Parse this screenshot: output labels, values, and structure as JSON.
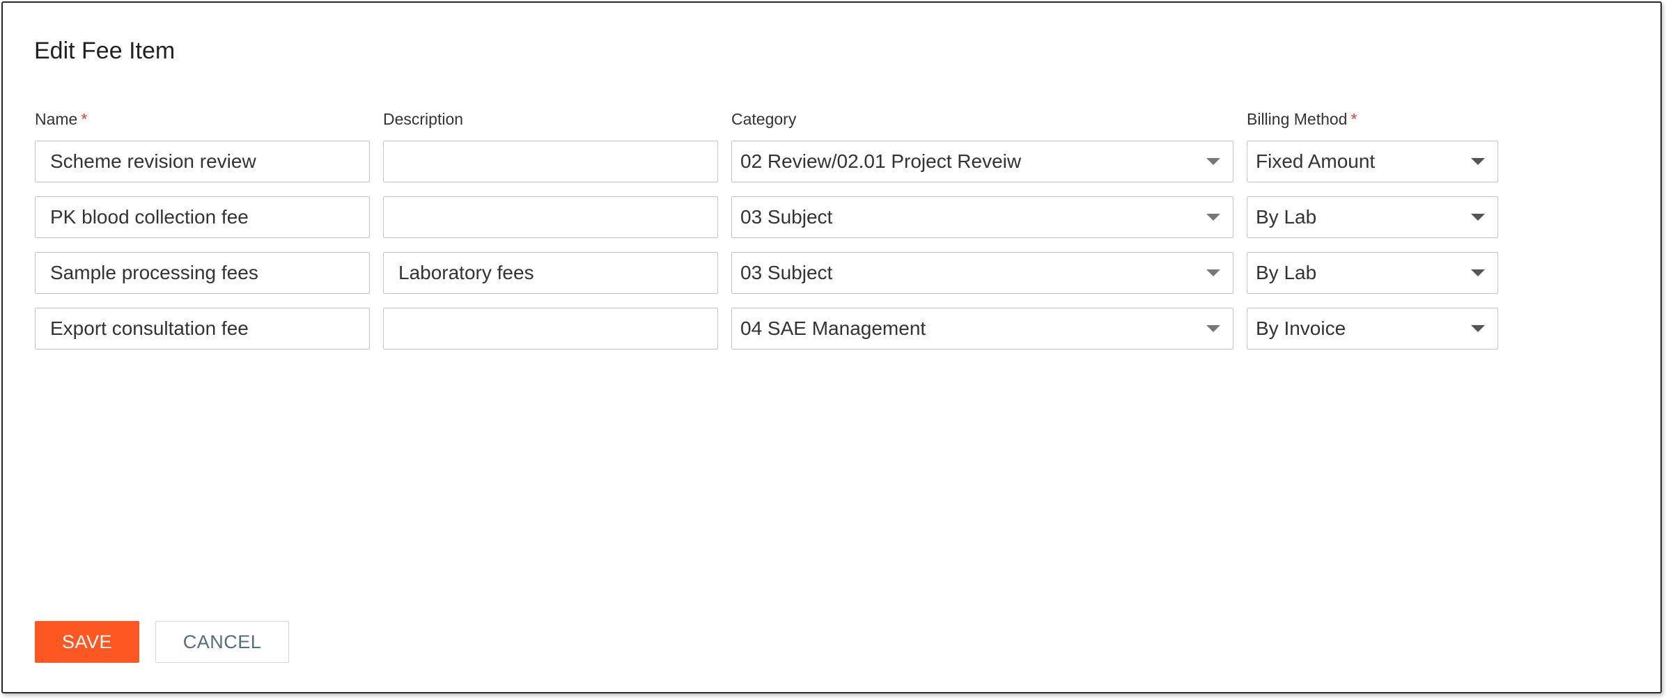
{
  "dialog": {
    "title": "Edit Fee Item"
  },
  "headers": {
    "name": "Name",
    "description": "Description",
    "category": "Category",
    "billing_method": "Billing Method",
    "required_mark": "*"
  },
  "rows": [
    {
      "name": "Scheme revision review",
      "description": "",
      "category": "02 Review/02.01 Project Reveiw",
      "billing_method": "Fixed Amount"
    },
    {
      "name": "PK blood collection fee",
      "description": "",
      "category": "03 Subject",
      "billing_method": "By Lab"
    },
    {
      "name": "Sample processing fees",
      "description": "Laboratory fees",
      "category": "03 Subject",
      "billing_method": "By Lab"
    },
    {
      "name": "Export consultation fee",
      "description": "",
      "category": "04 SAE Management",
      "billing_method": "By Invoice"
    }
  ],
  "actions": {
    "save": "SAVE",
    "cancel": "CANCEL"
  },
  "colors": {
    "primary": "#ff5722",
    "required": "#e53935",
    "cancel_text": "#546e7a"
  },
  "icons": {
    "dropdown": "chevron-down-icon"
  }
}
